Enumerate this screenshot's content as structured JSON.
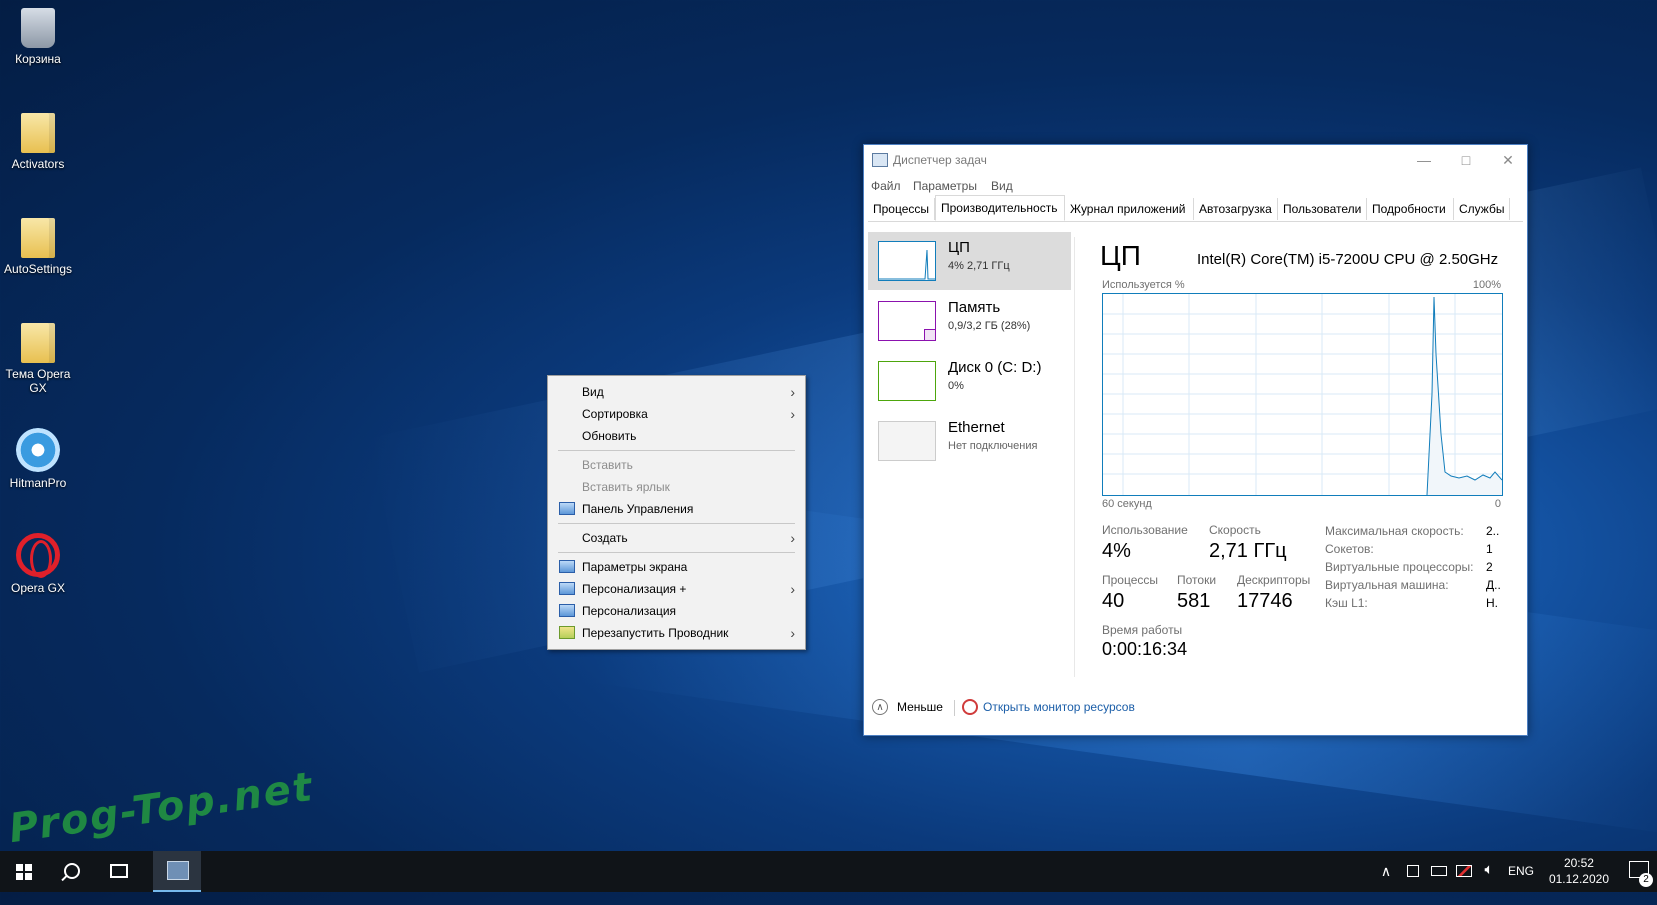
{
  "desktop": {
    "icons": [
      {
        "label": "Корзина",
        "icon": "recycle-bin-icon"
      },
      {
        "label": "Activators",
        "icon": "folder-icon"
      },
      {
        "label": "AutoSettings",
        "icon": "folder-icon"
      },
      {
        "label": "Тема Opera GX",
        "icon": "folder-icon"
      },
      {
        "label": "HitmanPro",
        "icon": "hitmanpro-icon"
      },
      {
        "label": "Opera GX",
        "icon": "opera-gx-icon"
      }
    ]
  },
  "context_menu": {
    "items": [
      {
        "label": "Вид",
        "submenu": true,
        "enabled": true
      },
      {
        "label": "Сортировка",
        "submenu": true,
        "enabled": true
      },
      {
        "label": "Обновить",
        "submenu": false,
        "enabled": true
      },
      {
        "label": "Вставить",
        "submenu": false,
        "enabled": false
      },
      {
        "label": "Вставить ярлык",
        "submenu": false,
        "enabled": false
      },
      {
        "label": "Панель Управления",
        "submenu": false,
        "enabled": true,
        "icon": "control-panel-icon"
      },
      {
        "label": "Создать",
        "submenu": true,
        "enabled": true
      },
      {
        "label": "Параметры экрана",
        "submenu": false,
        "enabled": true,
        "icon": "display-settings-icon"
      },
      {
        "label": "Персонализация +",
        "submenu": true,
        "enabled": true,
        "icon": "personalization-icon"
      },
      {
        "label": "Персонализация",
        "submenu": false,
        "enabled": true,
        "icon": "personalization-icon"
      },
      {
        "label": "Перезапустить Проводник",
        "submenu": true,
        "enabled": true,
        "icon": "explorer-icon"
      }
    ]
  },
  "task_manager": {
    "title": "Диспетчер задач",
    "menu": [
      "Файл",
      "Параметры",
      "Вид"
    ],
    "tabs": [
      "Процессы",
      "Производительность",
      "Журнал приложений",
      "Автозагрузка",
      "Пользователи",
      "Подробности",
      "Службы"
    ],
    "active_tab": "Производительность",
    "resources": [
      {
        "name": "ЦП",
        "sub": "4% 2,71 ГГц",
        "color": "#117dbb"
      },
      {
        "name": "Память",
        "sub": "0,9/3,2 ГБ (28%)",
        "color": "#8b12ae"
      },
      {
        "name": "Диск 0 (C: D:)",
        "sub": "0%",
        "color": "#4da60c"
      },
      {
        "name": "Ethernet",
        "sub": "Нет подключения",
        "color": "#cccccc"
      }
    ],
    "cpu": {
      "title": "ЦП",
      "model": "Intel(R) Core(TM) i5-7200U CPU @ 2.50GHz",
      "graph_label": "Используется %",
      "graph_max": "100%",
      "graph_time": "60 секунд",
      "graph_min": "0",
      "stats": {
        "usage_label": "Использование",
        "usage": "4%",
        "speed_label": "Скорость",
        "speed": "2,71 ГГц",
        "processes_label": "Процессы",
        "processes": "40",
        "threads_label": "Потоки",
        "threads": "581",
        "handles_label": "Дескрипторы",
        "handles": "17746",
        "uptime_label": "Время работы",
        "uptime": "0:00:16:34"
      },
      "specs": [
        {
          "label": "Максимальная скорость:",
          "value": "2.."
        },
        {
          "label": "Сокетов:",
          "value": "1"
        },
        {
          "label": "Виртуальные процессоры:",
          "value": "2"
        },
        {
          "label": "Виртуальная машина:",
          "value": "Д.."
        },
        {
          "label": "Кэш L1:",
          "value": "Н."
        }
      ]
    },
    "footer": {
      "less": "Меньше",
      "resource_monitor": "Открыть монитор ресурсов"
    }
  },
  "taskbar": {
    "language": "ENG",
    "time": "20:52",
    "date": "01.12.2020",
    "notifications_count": "2"
  },
  "watermark": "Prog-Top.net"
}
